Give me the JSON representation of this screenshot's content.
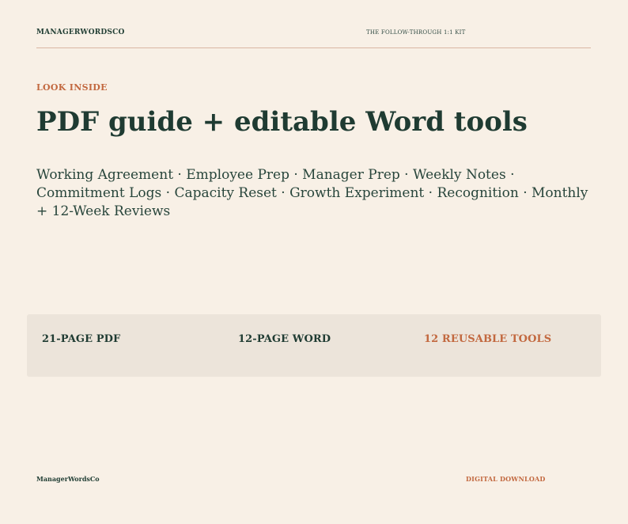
{
  "header": {
    "brand": "MANAGERWORDSCO",
    "kit_title": "THE FOLLOW-THROUGH 1:1 KIT"
  },
  "hero": {
    "eyebrow": "LOOK INSIDE",
    "headline": "PDF guide + editable Word tools",
    "description": "Working Agreement · Employee Prep · Manager Prep · Weekly Notes · Commitment Logs · Capacity Reset · Growth Experiment · Recognition · Monthly + 12-Week Reviews"
  },
  "stats": [
    {
      "label": "21-PAGE PDF"
    },
    {
      "label": "12-PAGE WORD"
    },
    {
      "label": "12 REUSABLE TOOLS"
    }
  ],
  "footer": {
    "brand": "ManagerWordsCo",
    "cta": "DIGITAL DOWNLOAD"
  },
  "colors": {
    "background": "#f8f0e6",
    "band": "#ece4da",
    "primary_text": "#1f3b32",
    "accent": "#c2683f",
    "rule": "#d9b6a3"
  }
}
